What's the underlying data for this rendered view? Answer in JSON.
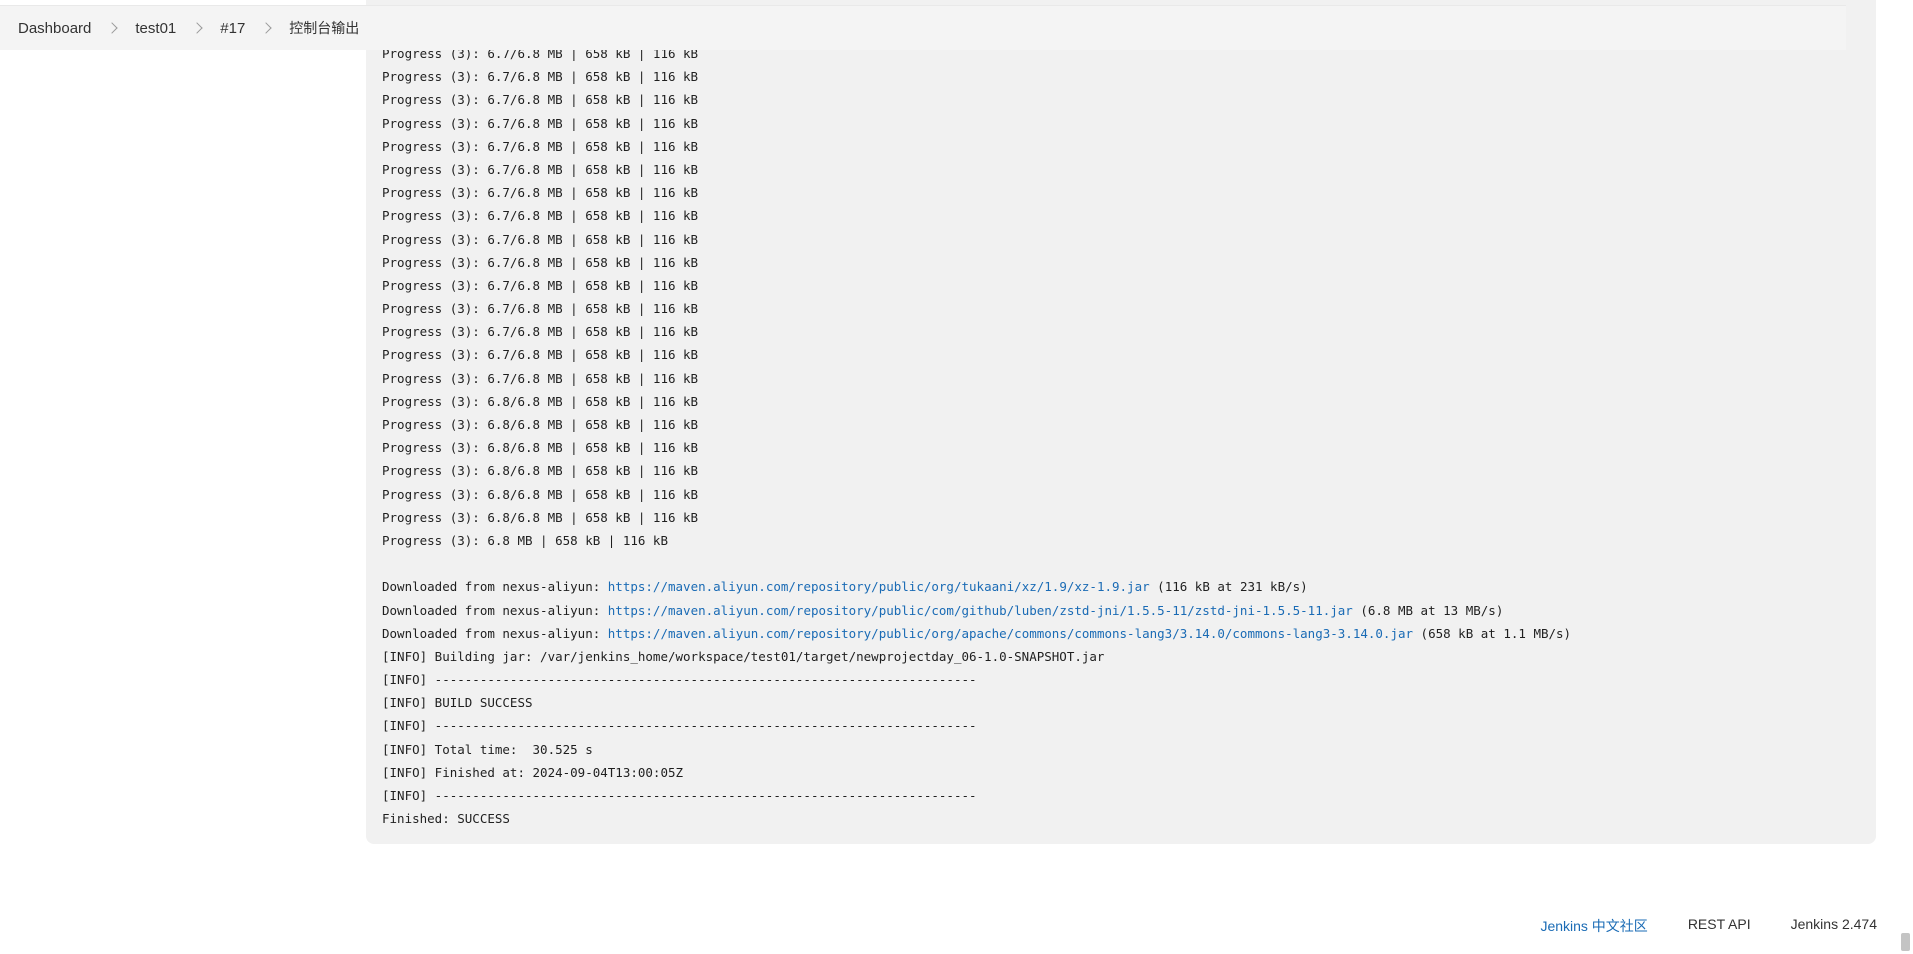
{
  "breadcrumb": {
    "items": [
      "Dashboard",
      "test01",
      "#17",
      "控制台输出"
    ]
  },
  "console": {
    "lines": [
      {
        "text": "Progress (3): 6.7/6.8 MB | 658 kB | 116 kB"
      },
      {
        "text": "Progress (3): 6.7/6.8 MB | 658 kB | 116 kB"
      },
      {
        "text": "Progress (3): 6.7/6.8 MB | 658 kB | 116 kB"
      },
      {
        "text": "Progress (3): 6.7/6.8 MB | 658 kB | 116 kB"
      },
      {
        "text": "Progress (3): 6.7/6.8 MB | 658 kB | 116 kB"
      },
      {
        "text": "Progress (3): 6.7/6.8 MB | 658 kB | 116 kB"
      },
      {
        "text": "Progress (3): 6.7/6.8 MB | 658 kB | 116 kB"
      },
      {
        "text": "Progress (3): 6.7/6.8 MB | 658 kB | 116 kB"
      },
      {
        "text": "Progress (3): 6.7/6.8 MB | 658 kB | 116 kB"
      },
      {
        "text": "Progress (3): 6.7/6.8 MB | 658 kB | 116 kB"
      },
      {
        "text": "Progress (3): 6.7/6.8 MB | 658 kB | 116 kB"
      },
      {
        "text": "Progress (3): 6.7/6.8 MB | 658 kB | 116 kB"
      },
      {
        "text": "Progress (3): 6.7/6.8 MB | 658 kB | 116 kB"
      },
      {
        "text": "Progress (3): 6.7/6.8 MB | 658 kB | 116 kB"
      },
      {
        "text": "Progress (3): 6.7/6.8 MB | 658 kB | 116 kB"
      },
      {
        "text": "Progress (3): 6.8/6.8 MB | 658 kB | 116 kB"
      },
      {
        "text": "Progress (3): 6.8/6.8 MB | 658 kB | 116 kB"
      },
      {
        "text": "Progress (3): 6.8/6.8 MB | 658 kB | 116 kB"
      },
      {
        "text": "Progress (3): 6.8/6.8 MB | 658 kB | 116 kB"
      },
      {
        "text": "Progress (3): 6.8/6.8 MB | 658 kB | 116 kB"
      },
      {
        "text": "Progress (3): 6.8/6.8 MB | 658 kB | 116 kB"
      },
      {
        "text": "Progress (3): 6.8 MB | 658 kB | 116 kB"
      },
      {
        "text": ""
      },
      {
        "prefix": "Downloaded from nexus-aliyun: ",
        "link": "https://maven.aliyun.com/repository/public/org/tukaani/xz/1.9/xz-1.9.jar",
        "suffix": " (116 kB at 231 kB/s)"
      },
      {
        "prefix": "Downloaded from nexus-aliyun: ",
        "link": "https://maven.aliyun.com/repository/public/com/github/luben/zstd-jni/1.5.5-11/zstd-jni-1.5.5-11.jar",
        "suffix": " (6.8 MB at 13 MB/s)"
      },
      {
        "prefix": "Downloaded from nexus-aliyun: ",
        "link": "https://maven.aliyun.com/repository/public/org/apache/commons/commons-lang3/3.14.0/commons-lang3-3.14.0.jar",
        "suffix": " (658 kB at 1.1 MB/s)"
      },
      {
        "text": "[INFO] Building jar: /var/jenkins_home/workspace/test01/target/newprojectday_06-1.0-SNAPSHOT.jar"
      },
      {
        "text": "[INFO] ------------------------------------------------------------------------"
      },
      {
        "text": "[INFO] BUILD SUCCESS"
      },
      {
        "text": "[INFO] ------------------------------------------------------------------------"
      },
      {
        "text": "[INFO] Total time:  30.525 s"
      },
      {
        "text": "[INFO] Finished at: 2024-09-04T13:00:05Z"
      },
      {
        "text": "[INFO] ------------------------------------------------------------------------"
      },
      {
        "text": "Finished: SUCCESS"
      }
    ]
  },
  "footer": {
    "community_link": "Jenkins 中文社区",
    "rest_api_link": "REST API",
    "version": "Jenkins 2.474"
  },
  "colors": {
    "link": "#1a6bb5",
    "console_bg": "#f1f1f1",
    "breadcrumb_bg": "#f4f4f4"
  }
}
